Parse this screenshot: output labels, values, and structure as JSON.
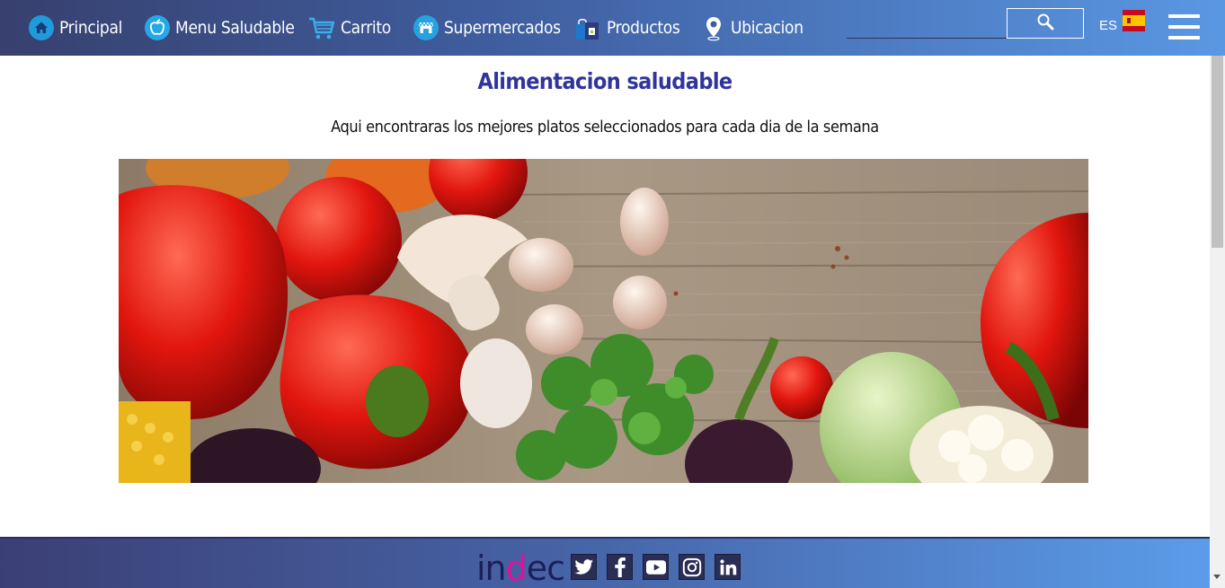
{
  "nav": {
    "items": [
      {
        "label": "Principal",
        "icon": "home-icon"
      },
      {
        "label": "Menu Saludable",
        "icon": "apple-icon"
      },
      {
        "label": "Carrito",
        "icon": "cart-icon"
      },
      {
        "label": "Supermercados",
        "icon": "store-icon"
      },
      {
        "label": "Productos",
        "icon": "bag-icon"
      },
      {
        "label": "Ubicacion",
        "icon": "location-pin-icon"
      }
    ],
    "search_icon": "search-icon",
    "lang": "ES",
    "flag_icon": "spain-flag-icon",
    "menu_icon": "hamburger-menu-icon"
  },
  "main": {
    "title": "Alimentacion saludable",
    "subtitle": "Aqui encontraras los mejores platos seleccionados para cada dia de la semana",
    "hero_image": "vegetables-on-wooden-table"
  },
  "footer": {
    "logo": {
      "part1": "in",
      "part2": "d",
      "part3": "ec"
    },
    "social": [
      "twitter-icon",
      "facebook-icon",
      "youtube-icon",
      "instagram-icon",
      "linkedin-icon"
    ]
  },
  "colors": {
    "title": "#2f3599",
    "nav_gradient_start": "#37406e",
    "nav_gradient_end": "#5a97e3"
  }
}
